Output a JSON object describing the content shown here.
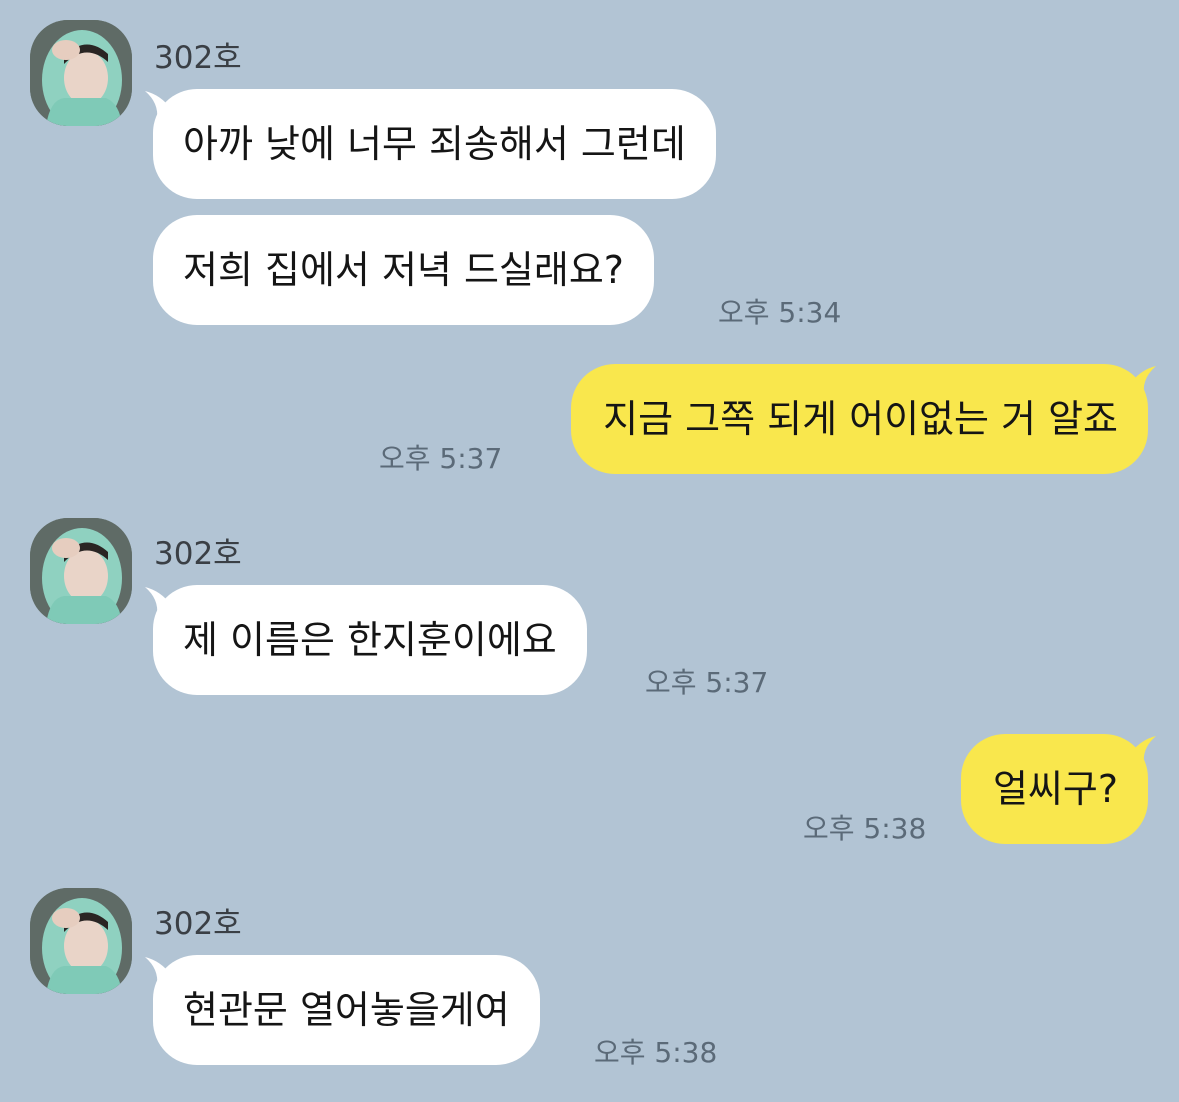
{
  "chat": {
    "colors": {
      "background": "#b2c4d4",
      "incoming_bubble": "#ffffff",
      "outgoing_bubble": "#f9e74d",
      "timestamp": "#5b6a78"
    },
    "messages": [
      {
        "sender": "302호",
        "text": "아까 낮에 너무 죄송해서 그런데",
        "direction": "incoming"
      },
      {
        "text": "저희 집에서 저녁 드실래요?",
        "time": "오후 5:34",
        "direction": "incoming"
      },
      {
        "text": "지금 그쪽 되게 어이없는 거 알죠",
        "time": "오후 5:37",
        "direction": "outgoing"
      },
      {
        "sender": "302호",
        "text": "제 이름은 한지훈이에요",
        "time": "오후 5:37",
        "direction": "incoming"
      },
      {
        "text": "얼씨구?",
        "time": "오후 5:38",
        "direction": "outgoing"
      },
      {
        "sender": "302호",
        "text": "현관문 열어놓을게여",
        "time": "오후 5:38",
        "direction": "incoming"
      }
    ],
    "avatar_icon": "profile-photo-icon"
  }
}
